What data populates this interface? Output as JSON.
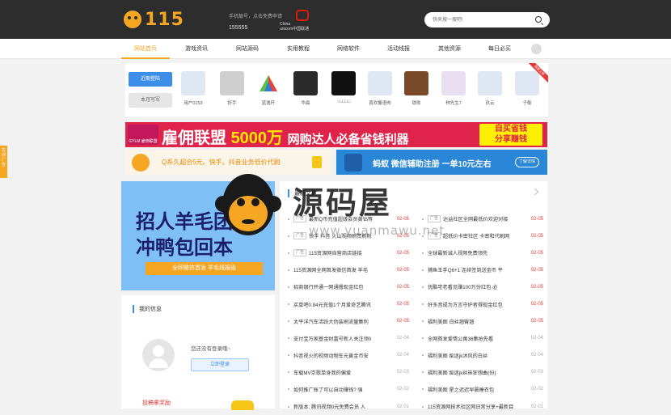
{
  "header": {
    "logo_text": "115",
    "promo_line1": "手机靓号，点击免费申请",
    "promo_line2": "155555",
    "unicom_line1": "China",
    "unicom_line2": "unicom中国联通",
    "search_placeholder": "快来搜一搜吧!"
  },
  "nav": {
    "items": [
      "网站首页",
      "游戏资讯",
      "网站源码",
      "实用教程",
      "网络软件",
      "活动线报",
      "其他资源",
      "每日必买"
    ]
  },
  "users": {
    "tab_active": "近期登陆",
    "tab_inactive": "本月写军",
    "ribbon": "我要上榜",
    "list": [
      "用户0153",
      "好手",
      "蓝逸阡",
      "华晨",
      "○□□□□",
      "喜欢馨语肉",
      "铁败",
      "林先生7",
      "玖云",
      "子衡"
    ]
  },
  "banner1": {
    "logo": "GYLM 雇佣联盟",
    "title_a": "雇佣联盟",
    "title_b": "5000万",
    "title_c": "网购达人必备省钱利器",
    "badge_line1": "自买省钱",
    "badge_line2": "分享赚钱"
  },
  "banner2": {
    "text": "Q系久超合5元。快手。抖音业务低价代刷"
  },
  "banner3": {
    "text": "蚂蚁 微信辅助注册 一单10元左右",
    "btn": "了解详情"
  },
  "side_tag": "关闭广告",
  "ad_big": {
    "line1": "招人羊毛团",
    "line2": "冲鸭包回本",
    "strip": "全网微信首发 羊毛线报组"
  },
  "login": {
    "title": "我的信息",
    "message": "您还没有登录哦~",
    "button": "立即登录",
    "reward": "投稿拿奖励"
  },
  "news": {
    "heading": "最新文章",
    "left": [
      {
        "tag": "广告",
        "title": "最新Q币充值超级会员黄钻等",
        "date": "02-05",
        "red": true
      },
      {
        "tag": "广告",
        "title": "快手 抖音 火山视频刷赞刷粉",
        "date": "02-05",
        "red": true
      },
      {
        "tag": "广告",
        "title": "115资源网自营商店链接",
        "date": "02-05",
        "red": true
      },
      {
        "tag": "",
        "title": "115资源网全网首发微信首发 羊毛",
        "date": "02-05",
        "red": true
      },
      {
        "tag": "",
        "title": "招商银行开通一网通撸现金红包",
        "date": "02-05",
        "red": true
      },
      {
        "tag": "",
        "title": "买单吧0.84元充值1个月爱奇艺腾讯",
        "date": "02-05",
        "red": true
      },
      {
        "tag": "",
        "title": "太平洋汽车活跃大伪装刷流量集利",
        "date": "02-05",
        "red": true
      },
      {
        "tag": "",
        "title": "支付宝万家基金财富号新人关注领0",
        "date": "02-04",
        "red": false
      },
      {
        "tag": "",
        "title": "抖音视火的视频动物车元黄金币安",
        "date": "02-04",
        "red": false
      },
      {
        "tag": "",
        "title": "车载MV京歌单身我的偏爱",
        "date": "02-03",
        "red": false
      },
      {
        "tag": "",
        "title": "如何推广账了可以自动赚钱? 强",
        "date": "02-02",
        "red": false
      },
      {
        "tag": "",
        "title": "新版本: 腾讯视频0元免费会员 人",
        "date": "02-01",
        "red": false
      }
    ],
    "right": [
      {
        "tag": "广告",
        "title": "达益社区全网最低价欢迎对接",
        "date": "02-05",
        "red": true
      },
      {
        "tag": "广告",
        "title": "超低价卡密社区 卡密和代刷网",
        "date": "02-05",
        "red": true
      },
      {
        "tag": "",
        "title": "全球最新诚人视频免费领先",
        "date": "02-05",
        "red": true
      },
      {
        "tag": "",
        "title": "捕鱼王手Q6+1 连续签到送金币 平",
        "date": "02-05",
        "red": true
      },
      {
        "tag": "",
        "title": "优酷宅老看见赚100万份红包 必",
        "date": "02-05",
        "red": true
      },
      {
        "tag": "",
        "title": "好多音成为方言守护者得现金红包",
        "date": "02-05",
        "red": true
      },
      {
        "tag": "",
        "title": "福利美图 白丝翘臀翘",
        "date": "02-05",
        "red": true
      },
      {
        "tag": "",
        "title": "全网首发爱情公寓36集抢先看",
        "date": "02-04",
        "red": false
      },
      {
        "tag": "",
        "title": "福利美图 痴迷jk沐风的白丝",
        "date": "02-04",
        "red": false
      },
      {
        "tag": "",
        "title": "福利美图 痴迷jk丝袜狂想曲(份)",
        "date": "02-03",
        "red": false
      },
      {
        "tag": "",
        "title": "福利美图 星之迟迟早晨睡衣包",
        "date": "02-02",
        "red": false
      },
      {
        "tag": "",
        "title": "115资源网技术社区网日常分享+最新目",
        "date": "02-01",
        "red": false
      }
    ]
  },
  "watermark": {
    "title": "源码屋",
    "url": "www.yuanmawu.net"
  },
  "colors": {
    "accent": "#f5a623",
    "blue": "#3d8ee8",
    "header_bg": "#2d2d2d",
    "date_red": "#e53935"
  }
}
